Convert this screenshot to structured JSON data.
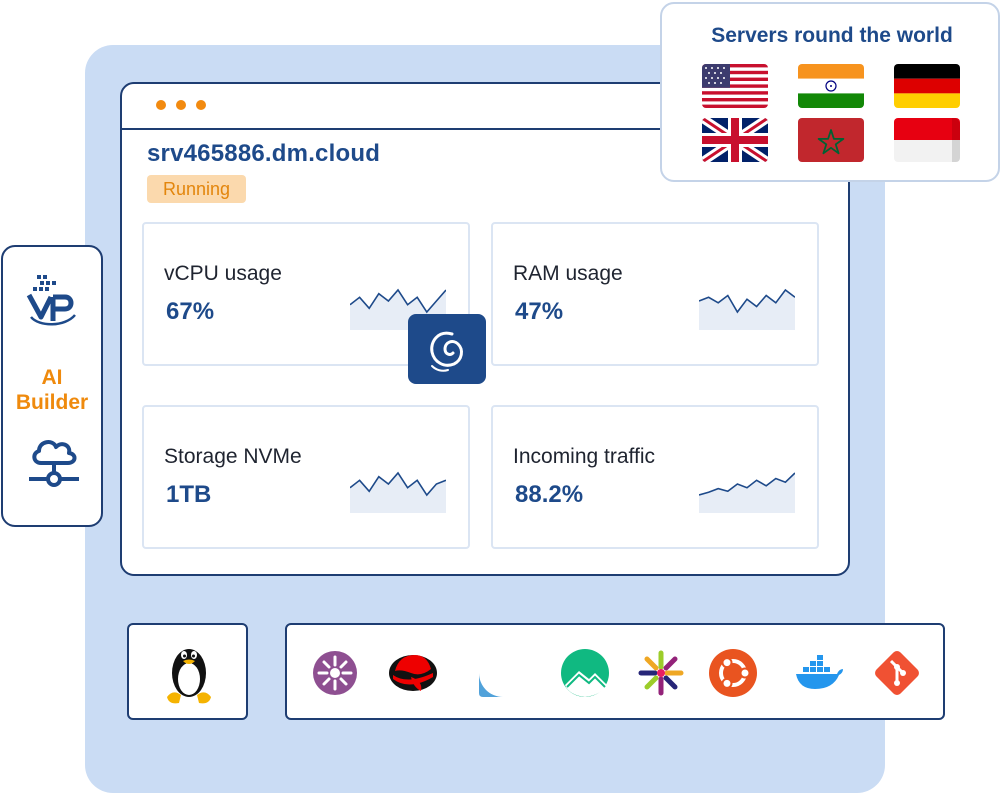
{
  "server": {
    "hostname": "srv465886.dm.cloud",
    "status": "Running",
    "os_badge_icon": "debian-icon"
  },
  "metrics": [
    {
      "label": "vCPU usage",
      "value": "67%",
      "spark": [
        8,
        10,
        7,
        11,
        9,
        12,
        8,
        10,
        6,
        9,
        12
      ]
    },
    {
      "label": "RAM usage",
      "value": "47%",
      "spark": [
        10,
        12,
        9,
        13,
        4,
        11,
        7,
        13,
        9,
        16,
        12
      ]
    },
    {
      "label": "Storage NVMe",
      "value": "1TB",
      "spark": [
        9,
        11,
        8,
        12,
        10,
        13,
        9,
        11,
        7,
        10,
        11
      ]
    },
    {
      "label": "Incoming traffic",
      "value": "88.2%",
      "spark": [
        2,
        5,
        9,
        6,
        14,
        10,
        18,
        12,
        20,
        16,
        26
      ]
    }
  ],
  "sidebar": {
    "logo_icon": "vps-logo-icon",
    "ai_label_line1": "AI",
    "ai_label_line2": "Builder",
    "network_icon": "cloud-network-icon"
  },
  "servers": {
    "title": "Servers round the world",
    "flags": [
      "United States",
      "India",
      "Germany",
      "United Kingdom",
      "Morocco",
      "Indonesia"
    ]
  },
  "os_list": [
    "linux-tux-icon",
    "almalinux-icon",
    "redhat-icon",
    "fedora-icon",
    "rocky-linux-icon",
    "centos-icon",
    "ubuntu-icon",
    "docker-icon",
    "git-icon"
  ],
  "colors": {
    "primary": "#1e4a8a",
    "accent": "#f28a0f",
    "background_panel": "#cadcf4",
    "status_bg": "#fbd9ad"
  }
}
